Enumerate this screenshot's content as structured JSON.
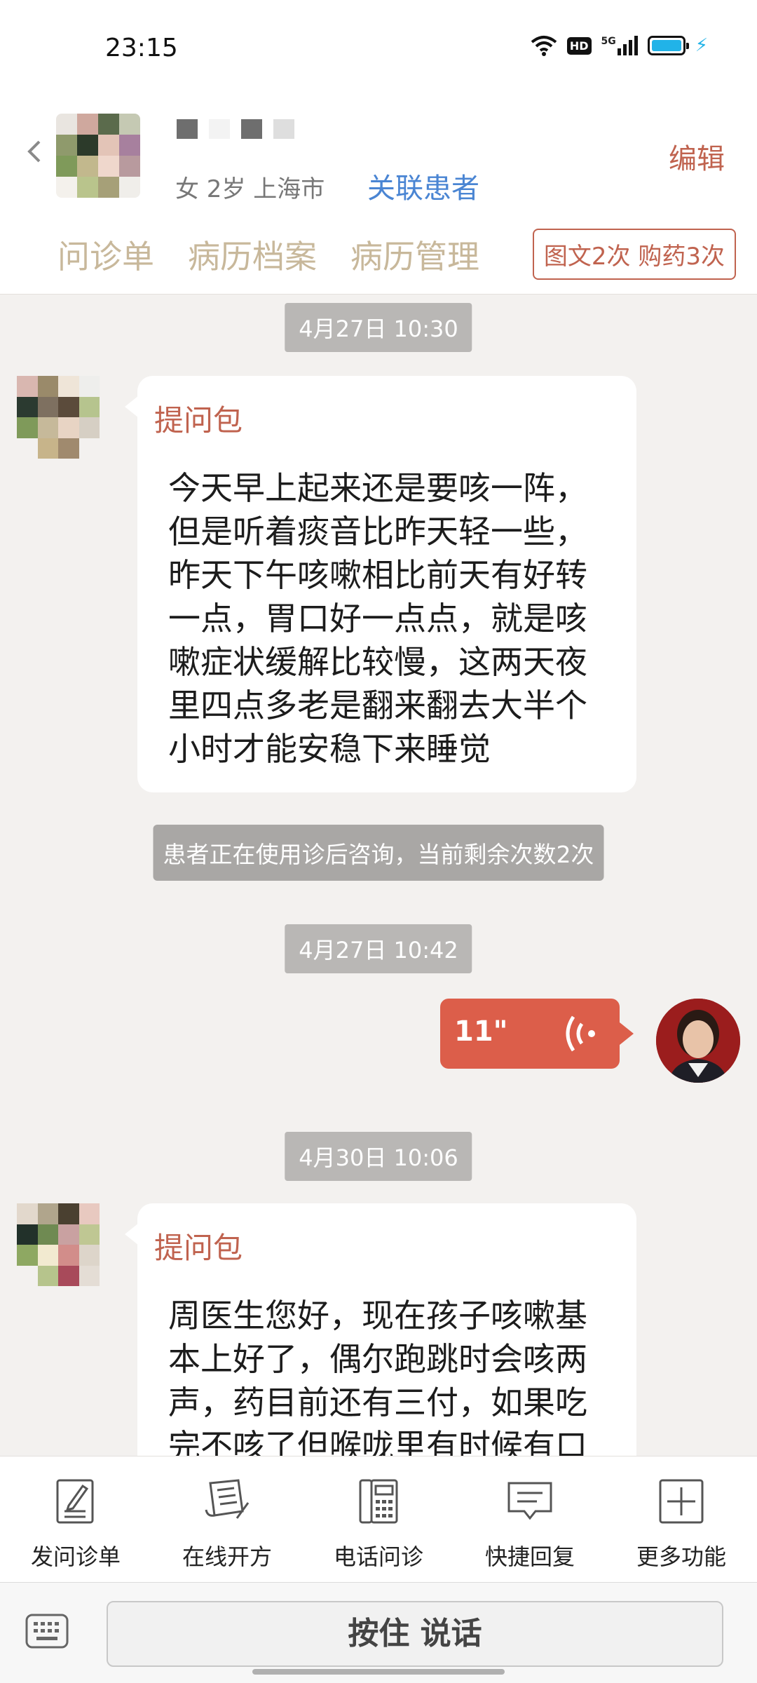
{
  "status_bar": {
    "time": "23:15",
    "hd_label": "HD",
    "network_label": "5G"
  },
  "header": {
    "patient_info": "女 2岁  上海市",
    "related_link": "关联患者",
    "edit_label": "编辑",
    "tabs": [
      "问诊单",
      "病历档案",
      "病历管理"
    ],
    "quota_badge": "图文2次 购药3次"
  },
  "messages": [
    {
      "time": "4月27日 10:30"
    },
    {
      "title": "提问包",
      "text": "今天早上起来还是要咳一阵，\n但是听着痰音比昨天轻一些，\n昨天下午咳嗽相比前天有好转\n一点，胃口好一点点，就是咳\n嗽症状缓解比较慢，这两天夜\n里四点多老是翻来翻去大半个\n小时才能安稳下来睡觉"
    },
    {
      "notice": "患者正在使用诊后咨询，当前剩余次数2次"
    },
    {
      "time": "4月27日 10:42"
    },
    {
      "voice_duration": "11\""
    },
    {
      "time": "4月30日 10:06"
    },
    {
      "title": "提问包",
      "text": "周医生您好，现在孩子咳嗽基\n本上好了，偶尔跑跳时会咳两\n声，药目前还有三付，如果吃\n完不咳了但喉咙里有时候有口"
    }
  ],
  "toolbar": [
    {
      "label": "发问诊单",
      "icon": "form-edit-icon"
    },
    {
      "label": "在线开方",
      "icon": "prescription-icon"
    },
    {
      "label": "电话问诊",
      "icon": "phone-icon"
    },
    {
      "label": "快捷回复",
      "icon": "quick-reply-icon"
    },
    {
      "label": "更多功能",
      "icon": "plus-icon"
    }
  ],
  "input": {
    "talk_label": "按住 说话"
  },
  "colors": {
    "accent": "#c0634f",
    "voice_bubble": "#dc5e4a",
    "tab_text": "#c8b89b",
    "link": "#4a85d3"
  }
}
